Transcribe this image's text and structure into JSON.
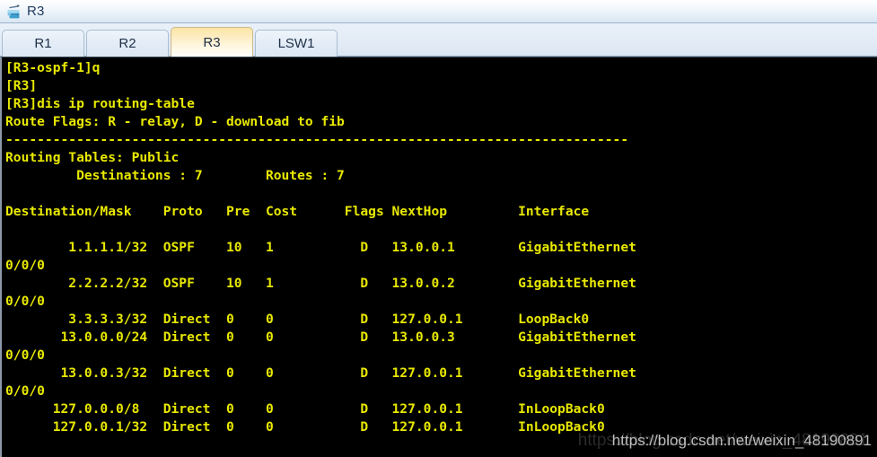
{
  "window": {
    "title": "R3",
    "icon": "router-icon"
  },
  "tabs": [
    {
      "label": "R1",
      "active": false
    },
    {
      "label": "R2",
      "active": false
    },
    {
      "label": "R3",
      "active": true
    },
    {
      "label": "LSW1",
      "active": false
    }
  ],
  "terminal": {
    "foreground": "#e8e800",
    "background": "#000000",
    "lines": [
      "[R3-ospf-1]q",
      "[R3]",
      "[R3]dis ip routing-table",
      "Route Flags: R - relay, D - download to fib",
      "-------------------------------------------------------------------------------",
      "Routing Tables: Public",
      "         Destinations : 7        Routes : 7",
      "",
      "Destination/Mask    Proto   Pre  Cost      Flags NextHop         Interface",
      "",
      "        1.1.1.1/32  OSPF    10   1           D   13.0.0.1        GigabitEthernet",
      "0/0/0",
      "        2.2.2.2/32  OSPF    10   1           D   13.0.0.2        GigabitEthernet",
      "0/0/0",
      "        3.3.3.3/32  Direct  0    0           D   127.0.0.1       LoopBack0",
      "       13.0.0.0/24  Direct  0    0           D   13.0.0.3        GigabitEthernet",
      "0/0/0",
      "       13.0.0.3/32  Direct  0    0           D   127.0.0.1       GigabitEthernet",
      "0/0/0",
      "      127.0.0.0/8   Direct  0    0           D   127.0.0.1       InLoopBack0",
      "      127.0.0.1/32  Direct  0    0           D   127.0.0.1       InLoopBack0"
    ],
    "command": "dis ip routing-table",
    "prompt": "[R3]",
    "route_flags_legend": "Route Flags: R - relay, D - download to fib",
    "routing_table_name": "Routing Tables: Public",
    "destinations_count": "7",
    "routes_count": "7",
    "columns": [
      "Destination/Mask",
      "Proto",
      "Pre",
      "Cost",
      "Flags",
      "NextHop",
      "Interface"
    ],
    "rows": [
      {
        "destination": "1.1.1.1/32",
        "proto": "OSPF",
        "pre": "10",
        "cost": "1",
        "flags": "D",
        "nexthop": "13.0.0.1",
        "interface": "GigabitEthernet0/0/0"
      },
      {
        "destination": "2.2.2.2/32",
        "proto": "OSPF",
        "pre": "10",
        "cost": "1",
        "flags": "D",
        "nexthop": "13.0.0.2",
        "interface": "GigabitEthernet0/0/0"
      },
      {
        "destination": "3.3.3.3/32",
        "proto": "Direct",
        "pre": "0",
        "cost": "0",
        "flags": "D",
        "nexthop": "127.0.0.1",
        "interface": "LoopBack0"
      },
      {
        "destination": "13.0.0.0/24",
        "proto": "Direct",
        "pre": "0",
        "cost": "0",
        "flags": "D",
        "nexthop": "13.0.0.3",
        "interface": "GigabitEthernet0/0/0"
      },
      {
        "destination": "13.0.0.3/32",
        "proto": "Direct",
        "pre": "0",
        "cost": "0",
        "flags": "D",
        "nexthop": "127.0.0.1",
        "interface": "GigabitEthernet0/0/0"
      },
      {
        "destination": "127.0.0.0/8",
        "proto": "Direct",
        "pre": "0",
        "cost": "0",
        "flags": "D",
        "nexthop": "127.0.0.1",
        "interface": "InLoopBack0"
      },
      {
        "destination": "127.0.0.1/32",
        "proto": "Direct",
        "pre": "0",
        "cost": "0",
        "flags": "D",
        "nexthop": "127.0.0.1",
        "interface": "InLoopBack0"
      }
    ]
  },
  "watermark": {
    "text": "https://blog.csdn.net/weixin_48190891"
  }
}
